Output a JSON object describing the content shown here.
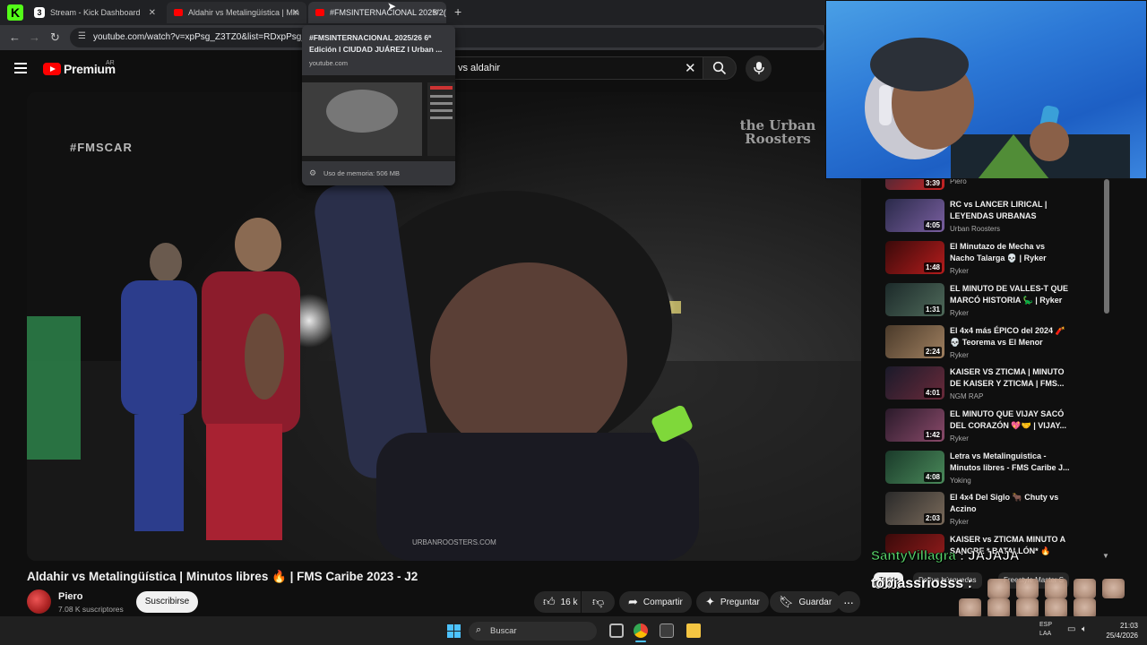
{
  "browser": {
    "tabs": [
      {
        "title": "Stream - Kick Dashboard",
        "favicon": "kick-icon"
      },
      {
        "title": "Aldahir vs Metalingüística | Min",
        "favicon": "youtube-icon"
      },
      {
        "title": "#FMSINTERNACIONAL 2025/2(",
        "favicon": "youtube-icon"
      }
    ],
    "new_tab_label": "+",
    "url": "youtube.com/watch?v=xpPsg_Z3TZ0&list=RDxpPsg_Z3T",
    "tab_popup": {
      "title": "#FMSINTERNACIONAL 2025/26 6ª Edición I CIUDAD JUÁREZ I Urban ...",
      "url": "youtube.com",
      "memory": "Uso de memoria: 506 MB"
    }
  },
  "youtube": {
    "logo_text": "Premium",
    "country": "AR",
    "search_value": "vs aldahir",
    "video": {
      "title": "Aldahir vs Metalingüística | Minutos libres 🔥 | FMS Caribe 2023 - J2",
      "watermark_left": "#FMSCAR",
      "watermark_right": "the Urban Roosters",
      "watermark_bottom": "URBANROOSTERS.COM"
    },
    "channel": {
      "name": "Piero",
      "subscribers": "7.08 K suscriptores"
    },
    "subscribe_label": "Suscribirse",
    "actions": {
      "likes": "16 k",
      "share": "Compartir",
      "ask": "Preguntar",
      "save": "Guardar"
    },
    "recommendations": [
      {
        "title": "",
        "channel": "Piero",
        "duration": "3:39",
        "colors": [
          "#3a2a3a",
          "#c22"
        ]
      },
      {
        "title": "RC vs LANCER LIRICAL | LEYENDAS URBANAS",
        "channel": "Urban Roosters",
        "duration": "4:05",
        "colors": [
          "#2a2a4a",
          "#7a5fa0"
        ]
      },
      {
        "title": "El Minutazo de Mecha vs Nacho Talarga 💀 | Ryker",
        "channel": "Ryker",
        "duration": "1:48",
        "colors": [
          "#3a0a0a",
          "#b51c1c"
        ]
      },
      {
        "title": "EL MINUTO DE VALLES-T QUE MARCÓ HISTORIA 🦕 | Ryker",
        "channel": "Ryker",
        "duration": "1:31",
        "colors": [
          "#1c2a2a",
          "#4f6a5a"
        ]
      },
      {
        "title": "El 4x4 más ÉPICO del 2024 🧨 💀 Teorema vs El Menor",
        "channel": "Ryker",
        "duration": "2:24",
        "colors": [
          "#4a3a2a",
          "#a08060"
        ]
      },
      {
        "title": "KAISER VS ZTICMA | MINUTO DE KAISER Y ZTICMA | FMS...",
        "channel": "NGM RAP",
        "duration": "4:01",
        "colors": [
          "#1a1a2a",
          "#6a2a3a"
        ]
      },
      {
        "title": "EL MINUTO QUE VIJAY SACÓ DEL CORAZÓN 💖🤝 | VIJAY...",
        "channel": "Ryker",
        "duration": "1:42",
        "colors": [
          "#2a1a2a",
          "#8a4a6a"
        ]
      },
      {
        "title": "Letra vs Metalinguistica - Minutos libres - FMS Caribe J...",
        "channel": "Yoking",
        "duration": "4:08",
        "colors": [
          "#1a3a2a",
          "#4a8a5a"
        ]
      },
      {
        "title": "El 4x4 Del Siglo 🐂 Chuty vs Aczino",
        "channel": "Ryker",
        "duration": "2:03",
        "colors": [
          "#2a2a2a",
          "#7a6a5a"
        ]
      },
      {
        "title": "KAISER vs ZTICMA MINUTO A SANGRE * BATALLÓN* 🔥",
        "channel": "",
        "duration": "",
        "colors": [
          "#3a0a0a",
          "#8a1a1a"
        ]
      }
    ]
  },
  "chat": {
    "line1_user": "SantyVillagra",
    "line1_msg": " : JAJAJA",
    "line2_user": "tobiassriosss",
    "line2_msg": " :",
    "chips": [
      "Todos",
      "De tus búsquedas",
      "Freestyle Master S"
    ]
  },
  "taskbar": {
    "search": "Buscar",
    "lang1": "ESP",
    "lang2": "LAA",
    "time": "21:03",
    "date": "25/4/2026"
  },
  "colors": {
    "youtube_red": "#ff0000",
    "kick_green": "#53fc18",
    "chat_green": "#59d26a"
  }
}
